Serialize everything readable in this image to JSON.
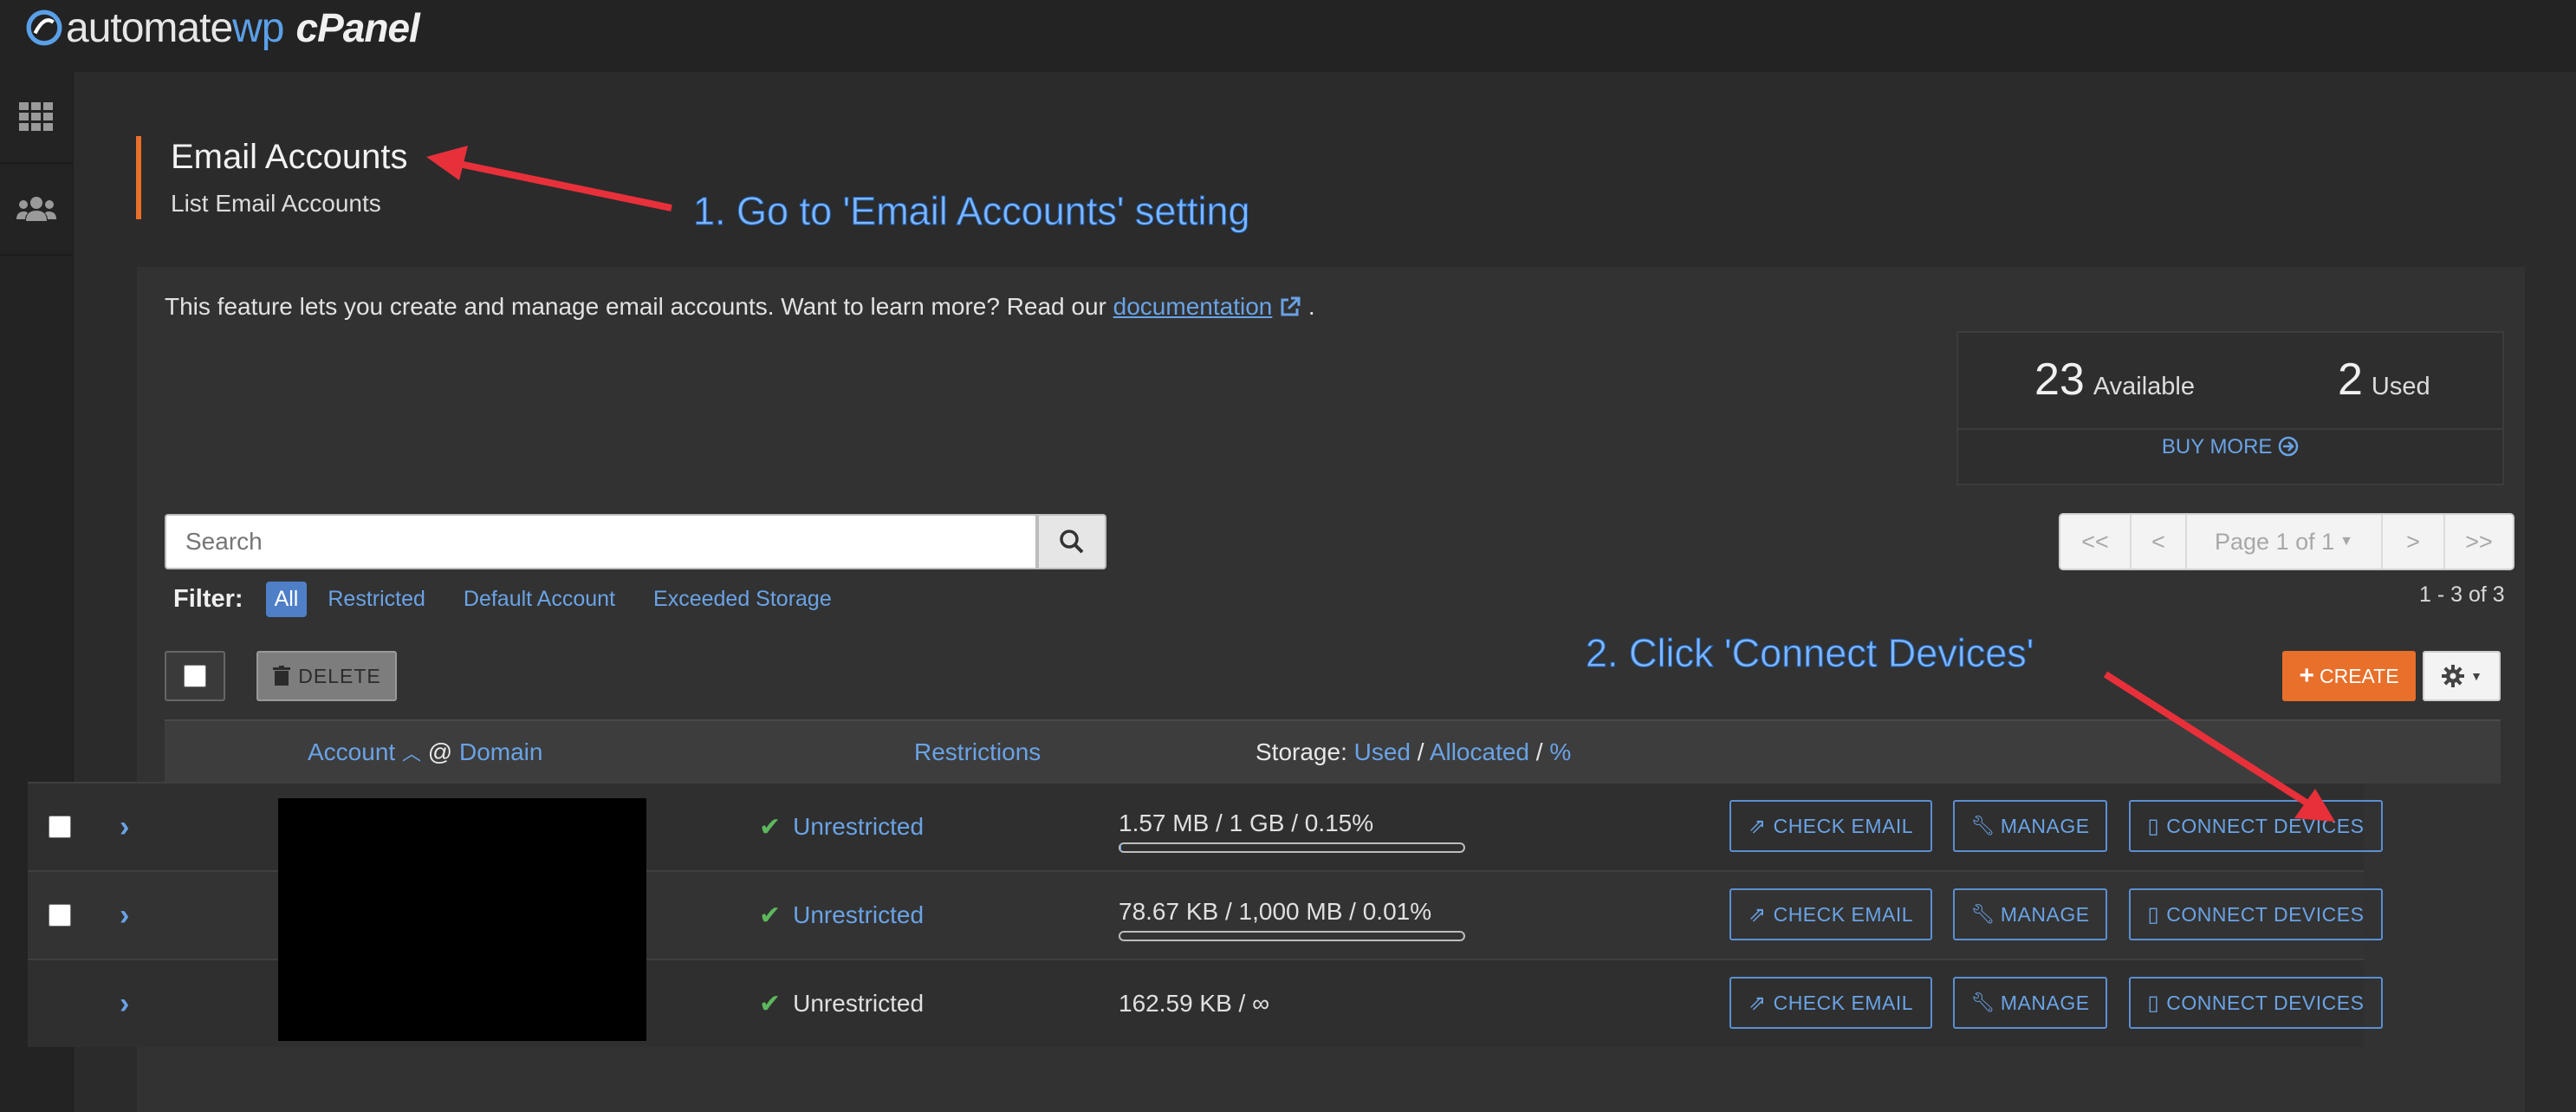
{
  "header": {
    "logo_part1": "automate",
    "logo_part2": "wp",
    "logo_part3": "cPanel"
  },
  "sidebar": {
    "items": [
      {
        "icon": "grid-icon"
      },
      {
        "icon": "users-icon"
      }
    ]
  },
  "page": {
    "title": "Email Accounts",
    "subtitle": "List Email Accounts"
  },
  "intro": {
    "text": "This feature lets you create and manage email accounts. Want to learn more? Read our ",
    "link": "documentation",
    "suffix": "."
  },
  "stats": {
    "available_num": "23",
    "available_label": "Available",
    "used_num": "2",
    "used_label": "Used",
    "buy_more": "BUY MORE"
  },
  "search": {
    "placeholder": "Search"
  },
  "pager": {
    "first": "<<",
    "prev": "<",
    "page": "Page 1 of 1",
    "next": ">",
    "last": ">>",
    "count": "1 - 3 of 3"
  },
  "filter": {
    "label": "Filter:",
    "options": [
      "All",
      "Restricted",
      "Default Account",
      "Exceeded Storage"
    ]
  },
  "toolbar": {
    "delete": "DELETE",
    "create": "CREATE"
  },
  "table": {
    "headers": {
      "account": "Account",
      "at": "@",
      "domain": "Domain",
      "restrictions": "Restrictions",
      "storage": "Storage:",
      "used": "Used",
      "slash": "/",
      "allocated": "Allocated",
      "percent": "%"
    },
    "rows": [
      {
        "restriction": "Unrestricted",
        "storage": "1.57 MB / 1 GB / 0.15%",
        "usage": 0.0015,
        "check": "CHECK EMAIL",
        "manage": "MANAGE",
        "connect": "CONNECT DEVICES"
      },
      {
        "restriction": "Unrestricted",
        "storage": "78.67 KB / 1,000 MB / 0.01%",
        "usage": 0.0001,
        "check": "CHECK EMAIL",
        "manage": "MANAGE",
        "connect": "CONNECT DEVICES"
      },
      {
        "restriction": "Unrestricted",
        "storage": "162.59 KB / ∞",
        "check": "CHECK EMAIL",
        "manage": "MANAGE",
        "connect": "CONNECT DEVICES"
      }
    ]
  },
  "annotations": {
    "step1": "1. Go to 'Email Accounts' setting",
    "step2": "2. Click 'Connect Devices'"
  },
  "colors": {
    "accent": "#e8702a",
    "link": "#6aa3e6",
    "success": "#5cb85c",
    "annotation_arrow": "#e8303a"
  }
}
